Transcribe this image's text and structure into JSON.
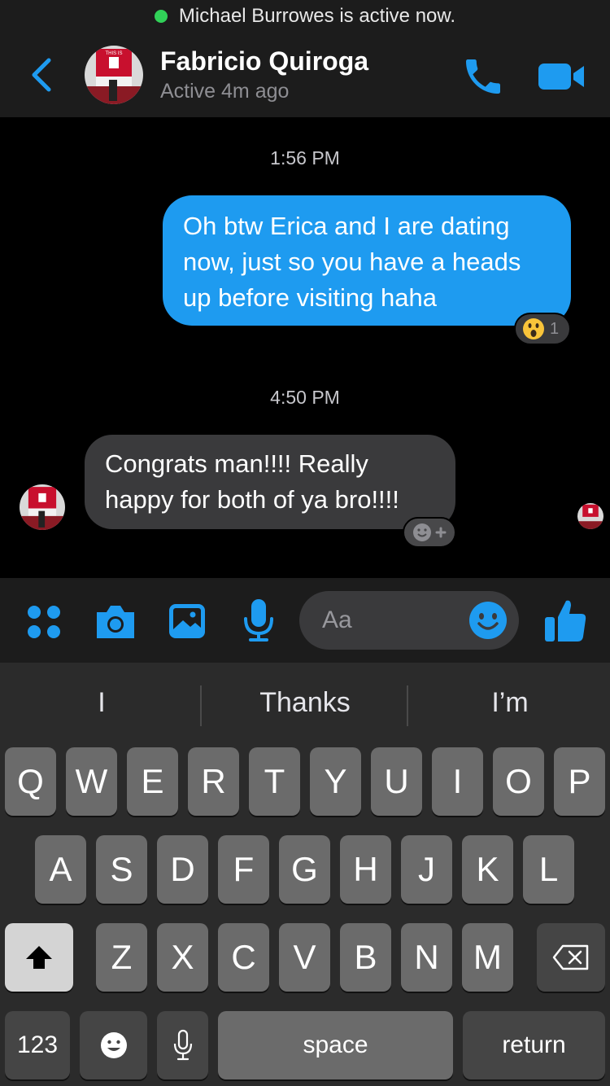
{
  "banner": {
    "text": "Michael Burrowes is active now."
  },
  "header": {
    "contact_name": "Fabricio Quiroga",
    "status": "Active 4m ago",
    "avatar_text": "THIS IS"
  },
  "messages": [
    {
      "timestamp": "1:56 PM",
      "text_lines": [
        "Oh btw Erica and I are dating",
        "now, just so you have a heads",
        "up before visiting haha"
      ],
      "reaction_count": "1"
    },
    {
      "timestamp": "4:50 PM",
      "text_lines": [
        "Congrats man!!!! Really",
        "happy for both of ya bro!!!!"
      ]
    }
  ],
  "composer": {
    "placeholder": "Aa"
  },
  "keyboard": {
    "suggestions": [
      "I",
      "Thanks",
      "I’m"
    ],
    "row1": [
      "Q",
      "W",
      "E",
      "R",
      "T",
      "Y",
      "U",
      "I",
      "O",
      "P"
    ],
    "row2": [
      "A",
      "S",
      "D",
      "F",
      "G",
      "H",
      "J",
      "K",
      "L"
    ],
    "row3": [
      "Z",
      "X",
      "C",
      "V",
      "B",
      "N",
      "M"
    ],
    "numbers_label": "123",
    "space_label": "space",
    "return_label": "return"
  },
  "colors": {
    "accent": "#1e9bf0",
    "online": "#31d158",
    "bubble_in": "#3a3a3c"
  }
}
